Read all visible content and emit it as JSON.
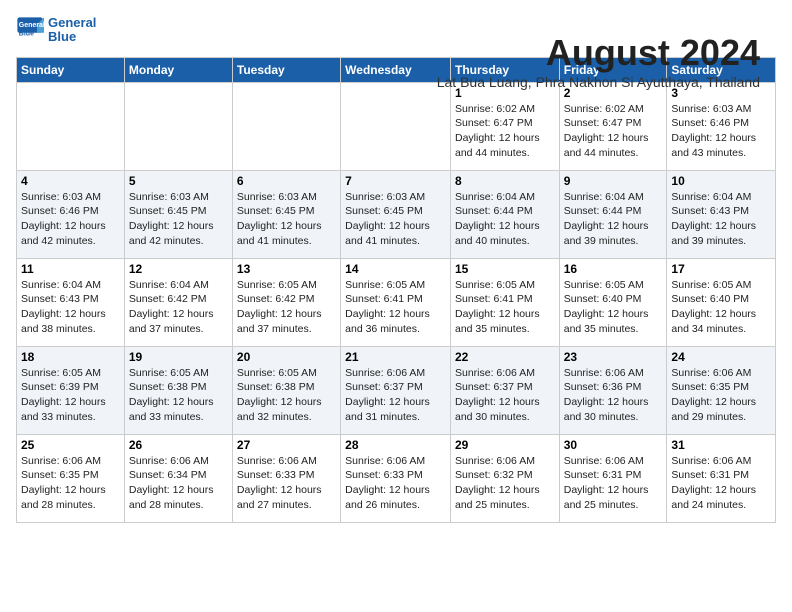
{
  "header": {
    "logo_line1": "General",
    "logo_line2": "Blue",
    "month_year": "August 2024",
    "location": "Lat Bua Luang, Phra Nakhon Si Ayutthaya, Thailand"
  },
  "weekdays": [
    "Sunday",
    "Monday",
    "Tuesday",
    "Wednesday",
    "Thursday",
    "Friday",
    "Saturday"
  ],
  "weeks": [
    [
      {
        "day": "",
        "info": ""
      },
      {
        "day": "",
        "info": ""
      },
      {
        "day": "",
        "info": ""
      },
      {
        "day": "",
        "info": ""
      },
      {
        "day": "1",
        "info": "Sunrise: 6:02 AM\nSunset: 6:47 PM\nDaylight: 12 hours\nand 44 minutes."
      },
      {
        "day": "2",
        "info": "Sunrise: 6:02 AM\nSunset: 6:47 PM\nDaylight: 12 hours\nand 44 minutes."
      },
      {
        "day": "3",
        "info": "Sunrise: 6:03 AM\nSunset: 6:46 PM\nDaylight: 12 hours\nand 43 minutes."
      }
    ],
    [
      {
        "day": "4",
        "info": "Sunrise: 6:03 AM\nSunset: 6:46 PM\nDaylight: 12 hours\nand 42 minutes."
      },
      {
        "day": "5",
        "info": "Sunrise: 6:03 AM\nSunset: 6:45 PM\nDaylight: 12 hours\nand 42 minutes."
      },
      {
        "day": "6",
        "info": "Sunrise: 6:03 AM\nSunset: 6:45 PM\nDaylight: 12 hours\nand 41 minutes."
      },
      {
        "day": "7",
        "info": "Sunrise: 6:03 AM\nSunset: 6:45 PM\nDaylight: 12 hours\nand 41 minutes."
      },
      {
        "day": "8",
        "info": "Sunrise: 6:04 AM\nSunset: 6:44 PM\nDaylight: 12 hours\nand 40 minutes."
      },
      {
        "day": "9",
        "info": "Sunrise: 6:04 AM\nSunset: 6:44 PM\nDaylight: 12 hours\nand 39 minutes."
      },
      {
        "day": "10",
        "info": "Sunrise: 6:04 AM\nSunset: 6:43 PM\nDaylight: 12 hours\nand 39 minutes."
      }
    ],
    [
      {
        "day": "11",
        "info": "Sunrise: 6:04 AM\nSunset: 6:43 PM\nDaylight: 12 hours\nand 38 minutes."
      },
      {
        "day": "12",
        "info": "Sunrise: 6:04 AM\nSunset: 6:42 PM\nDaylight: 12 hours\nand 37 minutes."
      },
      {
        "day": "13",
        "info": "Sunrise: 6:05 AM\nSunset: 6:42 PM\nDaylight: 12 hours\nand 37 minutes."
      },
      {
        "day": "14",
        "info": "Sunrise: 6:05 AM\nSunset: 6:41 PM\nDaylight: 12 hours\nand 36 minutes."
      },
      {
        "day": "15",
        "info": "Sunrise: 6:05 AM\nSunset: 6:41 PM\nDaylight: 12 hours\nand 35 minutes."
      },
      {
        "day": "16",
        "info": "Sunrise: 6:05 AM\nSunset: 6:40 PM\nDaylight: 12 hours\nand 35 minutes."
      },
      {
        "day": "17",
        "info": "Sunrise: 6:05 AM\nSunset: 6:40 PM\nDaylight: 12 hours\nand 34 minutes."
      }
    ],
    [
      {
        "day": "18",
        "info": "Sunrise: 6:05 AM\nSunset: 6:39 PM\nDaylight: 12 hours\nand 33 minutes."
      },
      {
        "day": "19",
        "info": "Sunrise: 6:05 AM\nSunset: 6:38 PM\nDaylight: 12 hours\nand 33 minutes."
      },
      {
        "day": "20",
        "info": "Sunrise: 6:05 AM\nSunset: 6:38 PM\nDaylight: 12 hours\nand 32 minutes."
      },
      {
        "day": "21",
        "info": "Sunrise: 6:06 AM\nSunset: 6:37 PM\nDaylight: 12 hours\nand 31 minutes."
      },
      {
        "day": "22",
        "info": "Sunrise: 6:06 AM\nSunset: 6:37 PM\nDaylight: 12 hours\nand 30 minutes."
      },
      {
        "day": "23",
        "info": "Sunrise: 6:06 AM\nSunset: 6:36 PM\nDaylight: 12 hours\nand 30 minutes."
      },
      {
        "day": "24",
        "info": "Sunrise: 6:06 AM\nSunset: 6:35 PM\nDaylight: 12 hours\nand 29 minutes."
      }
    ],
    [
      {
        "day": "25",
        "info": "Sunrise: 6:06 AM\nSunset: 6:35 PM\nDaylight: 12 hours\nand 28 minutes."
      },
      {
        "day": "26",
        "info": "Sunrise: 6:06 AM\nSunset: 6:34 PM\nDaylight: 12 hours\nand 28 minutes."
      },
      {
        "day": "27",
        "info": "Sunrise: 6:06 AM\nSunset: 6:33 PM\nDaylight: 12 hours\nand 27 minutes."
      },
      {
        "day": "28",
        "info": "Sunrise: 6:06 AM\nSunset: 6:33 PM\nDaylight: 12 hours\nand 26 minutes."
      },
      {
        "day": "29",
        "info": "Sunrise: 6:06 AM\nSunset: 6:32 PM\nDaylight: 12 hours\nand 25 minutes."
      },
      {
        "day": "30",
        "info": "Sunrise: 6:06 AM\nSunset: 6:31 PM\nDaylight: 12 hours\nand 25 minutes."
      },
      {
        "day": "31",
        "info": "Sunrise: 6:06 AM\nSunset: 6:31 PM\nDaylight: 12 hours\nand 24 minutes."
      }
    ]
  ]
}
